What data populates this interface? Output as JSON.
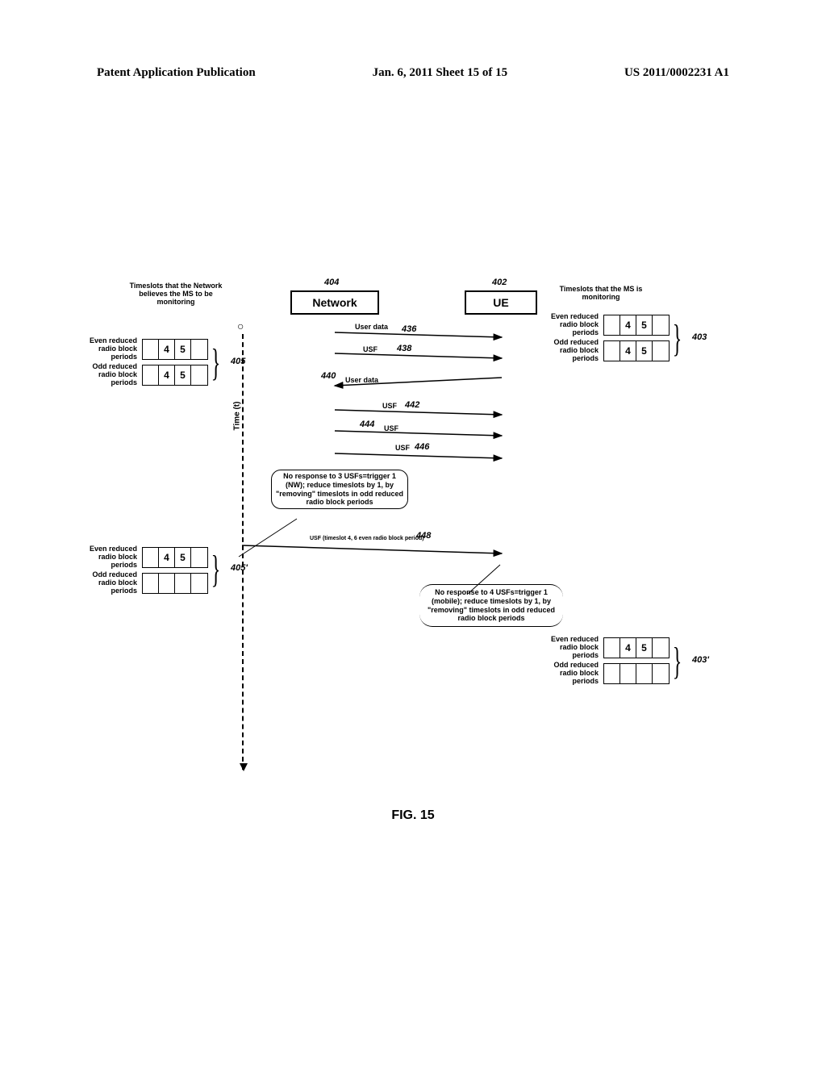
{
  "header": {
    "left": "Patent Application Publication",
    "center": "Jan. 6, 2011  Sheet 15 of 15",
    "right": "US 2011/0002231 A1"
  },
  "figure_label": "FIG. 15",
  "refs": {
    "network": "404",
    "ue": "402",
    "nw_state": "405",
    "nw_state2": "405'",
    "ue_state": "403",
    "ue_state2": "403'",
    "userdata1": "436",
    "usf1": "438",
    "userdata2": "440",
    "usf2": "442",
    "usf3": "444",
    "usf4": "446",
    "usf5": "448"
  },
  "boxes": {
    "network": "Network",
    "ue": "UE"
  },
  "labels": {
    "nw_title": "Timeslots that the Network believes the MS to be monitoring",
    "ue_title": "Timeslots that the MS is monitoring",
    "even": "Even reduced radio block periods",
    "odd": "Odd reduced radio block periods",
    "time": "Time (t)",
    "userdata": "User data",
    "usf": "USF",
    "usf_ts": "USF (timeslot 4, 6 even radio block period)",
    "nw_trigger": "No response to 3 USFs=trigger 1 (NW); reduce timeslots by 1, by \"removing\" timeslots in odd reduced radio block periods",
    "ue_trigger": "No response to 4 USFs=trigger 1 (mobile); reduce timeslots by 1, by \"removing\" timeslots in odd reduced radio block periods"
  },
  "slots": {
    "s4": "4",
    "s5": "5"
  }
}
